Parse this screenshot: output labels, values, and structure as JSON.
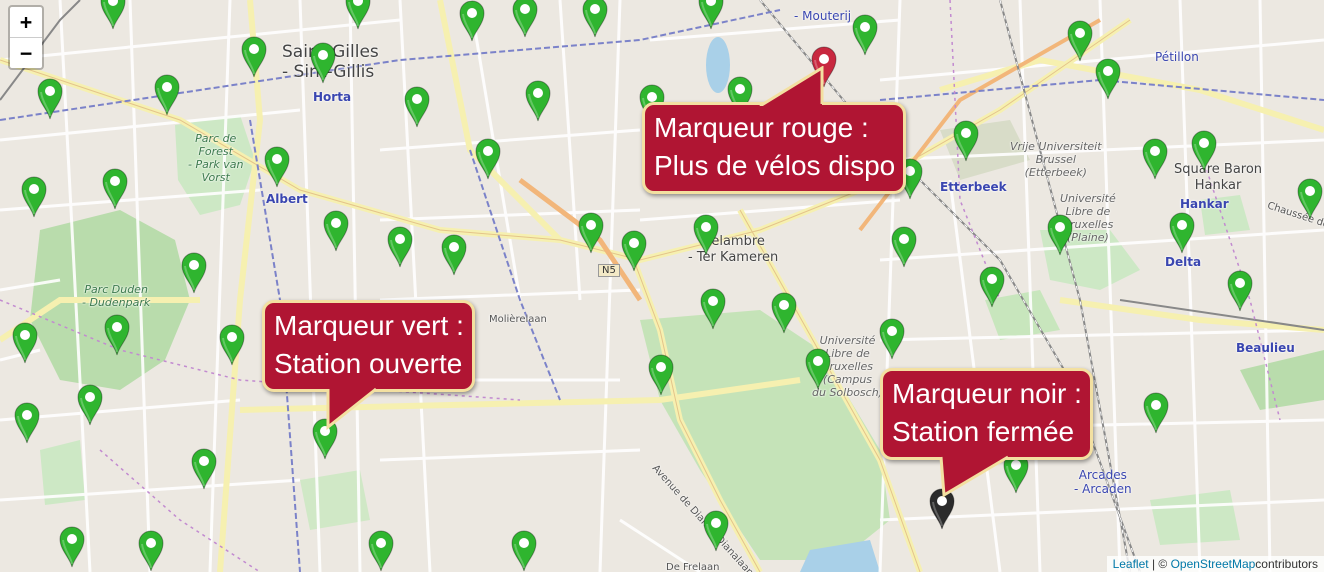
{
  "zoom": {
    "in_label": "+",
    "out_label": "−"
  },
  "labels": {
    "saint_gilles": "Saint-Gilles\n- Sint-Gillis",
    "horta": "Horta",
    "albert": "Albert",
    "parc_forest": "Parc de\nForest\n- Park van\nVorst",
    "parc_duden": "Parc Duden\n- Dudenpark",
    "mouterij": "- Mouterij",
    "petillon": "Pétillon",
    "vub": "Vrije Universiteit\nBrussel\n(Etterbeek)",
    "ulb_plaine": "Université\nLibre de\nBruxelles\n(Plaine)",
    "etterbeek": "Etterbeek",
    "square_baron": "Square Baron\nHankar",
    "hankar": "Hankar",
    "chaussee": "Chaussée de",
    "delta": "Delta",
    "delambre": "Delambre\n- Ter Kameren",
    "n5": "N5",
    "molierelaan": "Molièrelaan",
    "ulb_solbosch": "Université\nLibre de\nBruxelles\n(Campus\ndu Solbosch)",
    "avenue_diane": "Avenue de Diane - Dianalaan",
    "beaulieu": "Beaulieu",
    "arcades": "Arcades\n- Arcaden",
    "de_frelaan": "De Frelaan"
  },
  "callouts": {
    "red": "Marqueur rouge :\nPlus de vélos dispo",
    "green": "Marqueur vert :\nStation ouverte",
    "black": "Marqueur noir :\nStation fermée"
  },
  "marker_colors": {
    "green": "#2fb52f",
    "red": "#c8283f",
    "black": "#2b2b2b"
  },
  "callout_color": "#b01533",
  "attribution": {
    "leaflet": "Leaflet",
    "separator": " | © ",
    "osm": "OpenStreetMap",
    "suffix": "contributors"
  }
}
